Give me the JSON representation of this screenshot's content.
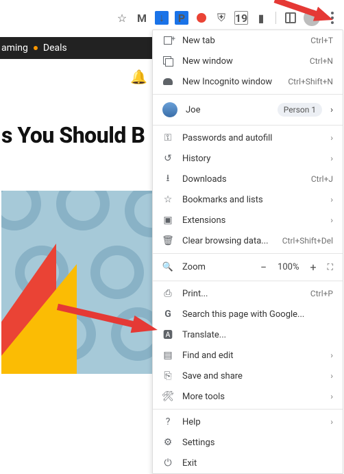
{
  "page": {
    "nav_strip": {
      "item1": "aming",
      "item2": "Deals"
    },
    "headline": "s You Should B"
  },
  "toolbar": {
    "calendar_badge": "19"
  },
  "profile": {
    "name": "Joe",
    "badge": "Person 1"
  },
  "menu": {
    "new_tab": {
      "label": "New tab",
      "shortcut": "Ctrl+T"
    },
    "new_window": {
      "label": "New window",
      "shortcut": "Ctrl+N"
    },
    "incognito": {
      "label": "New Incognito window",
      "shortcut": "Ctrl+Shift+N"
    },
    "passwords": {
      "label": "Passwords and autofill"
    },
    "history": {
      "label": "History"
    },
    "downloads": {
      "label": "Downloads",
      "shortcut": "Ctrl+J"
    },
    "bookmarks": {
      "label": "Bookmarks and lists"
    },
    "extensions": {
      "label": "Extensions"
    },
    "clear": {
      "label": "Clear browsing data...",
      "shortcut": "Ctrl+Shift+Del"
    },
    "zoom": {
      "label": "Zoom",
      "value": "100%"
    },
    "print": {
      "label": "Print...",
      "shortcut": "Ctrl+P"
    },
    "search": {
      "label": "Search this page with Google..."
    },
    "translate": {
      "label": "Translate..."
    },
    "find": {
      "label": "Find and edit"
    },
    "save_share": {
      "label": "Save and share"
    },
    "more_tools": {
      "label": "More tools"
    },
    "help": {
      "label": "Help"
    },
    "settings": {
      "label": "Settings"
    },
    "exit": {
      "label": "Exit"
    }
  }
}
